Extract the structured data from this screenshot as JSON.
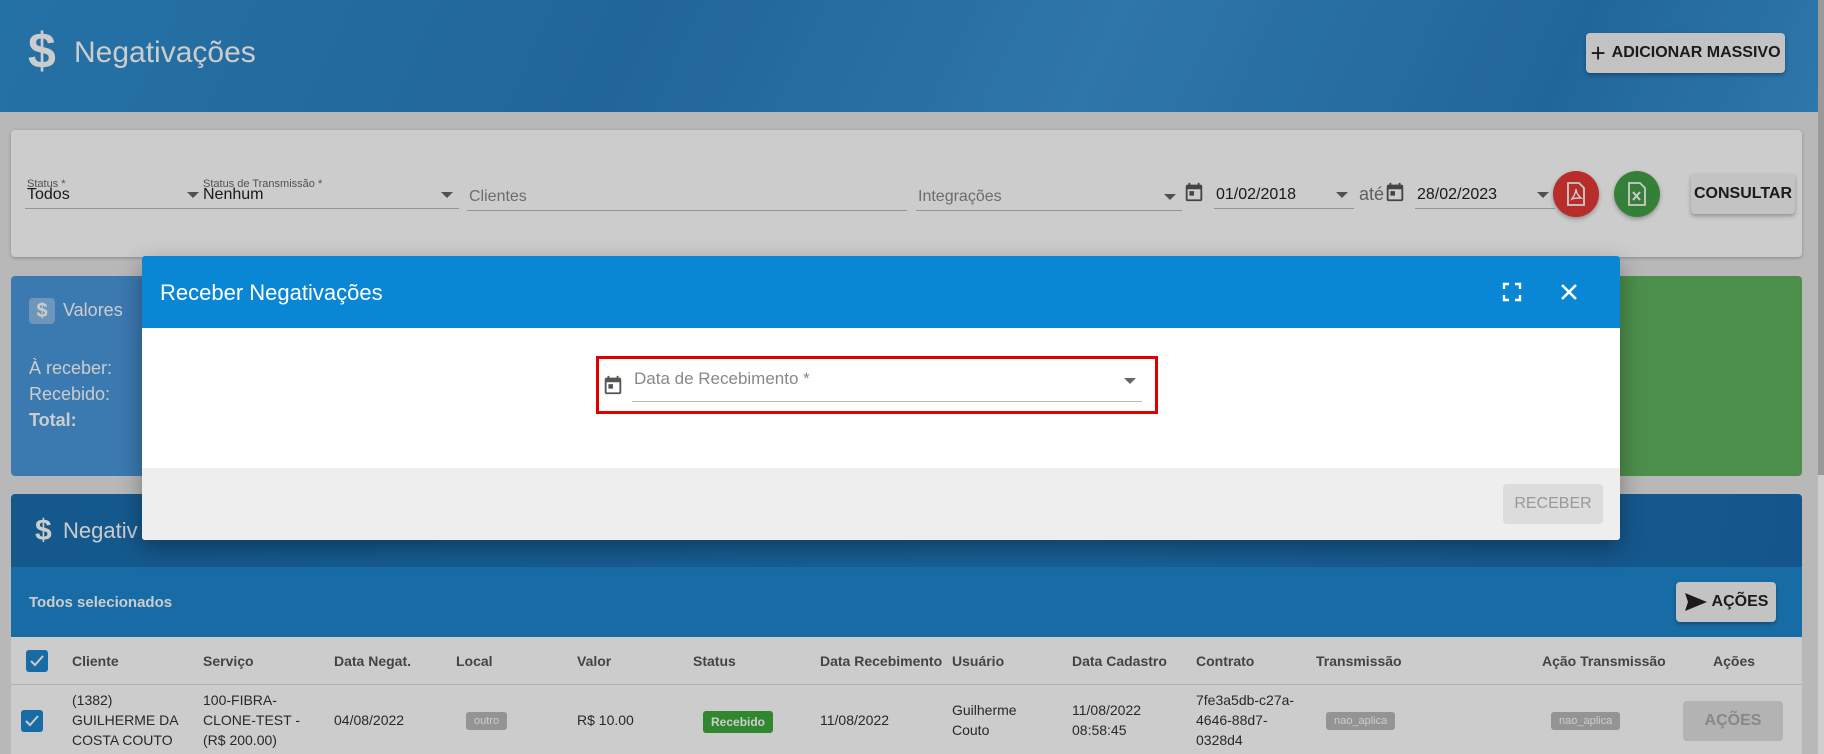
{
  "header": {
    "title": "Negativações",
    "add_massive_label": "ADICIONAR MASSIVO"
  },
  "filters": {
    "status_label": "Status *",
    "status_value": "Todos",
    "transmission_label": "Status de Transmissão *",
    "transmission_value": "Nenhum",
    "clients_placeholder": "Clientes",
    "integrations_placeholder": "Integrações",
    "date_from": "01/02/2018",
    "date_separator": "até",
    "date_to": "28/02/2023",
    "consult_label": "CONSULTAR"
  },
  "summary": {
    "title": "Valores",
    "to_receive_label": "À receber:",
    "received_label": "Recebido:",
    "total_label": "Total:"
  },
  "table": {
    "panel_title": "Negativ",
    "all_selected": "Todos selecionados",
    "actions_label": "AÇÕES",
    "columns": [
      "Cliente",
      "Serviço",
      "Data Negat.",
      "Local",
      "Valor",
      "Status",
      "Data Recebimento",
      "Usuário",
      "Data Cadastro",
      "Contrato",
      "Transmissão",
      "Ação Transmissão",
      "Ações"
    ],
    "rows": [
      {
        "cliente": [
          "(1382)",
          "GUILHERME DA",
          "COSTA COUTO"
        ],
        "servico": [
          "100-FIBRA-",
          "CLONE-TEST -",
          "(R$ 200.00)"
        ],
        "data_negat": "04/08/2022",
        "local": "outro",
        "valor": "R$ 10.00",
        "status": "Recebido",
        "data_recebimento": "11/08/2022",
        "usuario": [
          "Guilherme",
          "Couto"
        ],
        "data_cadastro": [
          "11/08/2022",
          "08:58:45"
        ],
        "contrato": [
          "7fe3a5db-c27a-",
          "4646-88d7-",
          "0328d4"
        ],
        "transmissao": "nao_aplica",
        "acao_transmissao": "nao_aplica",
        "acoes": "AÇÕES"
      }
    ]
  },
  "dialog": {
    "title": "Receber Negativações",
    "date_placeholder": "Data de Recebimento *",
    "receive_label": "RECEBER"
  },
  "colors": {
    "header_blue": "#2a7fc0",
    "dialog_blue": "#0a87d4",
    "highlight_red": "#e00000",
    "pdf_red": "#e53935",
    "excel_green": "#43a047",
    "status_green": "#3ea83d"
  },
  "icons": [
    "dollar-icon",
    "plus-icon",
    "calendar-icon",
    "pdf-icon",
    "excel-icon",
    "send-icon",
    "fullscreen-icon",
    "close-icon",
    "checkbox-icon",
    "caret-down-icon"
  ]
}
